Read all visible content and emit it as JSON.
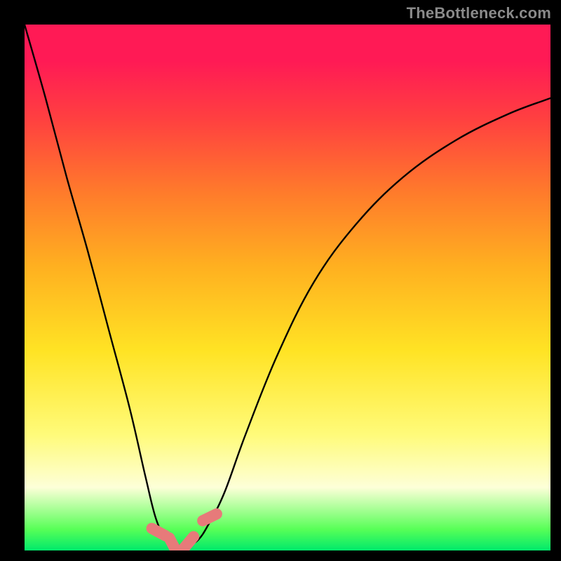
{
  "attribution": "TheBottleneck.com",
  "chart_data": {
    "type": "line",
    "title": "",
    "xlabel": "",
    "ylabel": "",
    "xlim": [
      0,
      100
    ],
    "ylim": [
      0,
      100
    ],
    "grid": false,
    "legend": false,
    "annotations": [],
    "series": [
      {
        "name": "bottleneck-curve",
        "color": "#000000",
        "x": [
          0,
          4,
          8,
          12,
          16,
          20,
          23,
          25,
          27,
          29,
          31,
          33,
          35,
          38,
          42,
          48,
          55,
          63,
          72,
          82,
          92,
          100
        ],
        "values": [
          100,
          86,
          71,
          57,
          42,
          27,
          14,
          6,
          2,
          1,
          1,
          2,
          5,
          11,
          22,
          37,
          51,
          62,
          71,
          78,
          83,
          86
        ]
      }
    ],
    "markers": [
      {
        "name": "optimal-marker-left",
        "shape": "pill",
        "color": "#e77a7a",
        "x": 25.5,
        "y": 3.5,
        "angle": -62
      },
      {
        "name": "optimal-marker-mid",
        "shape": "pill",
        "color": "#e77a7a",
        "x": 28.2,
        "y": 1.1,
        "angle": -28
      },
      {
        "name": "optimal-marker-low",
        "shape": "pill",
        "color": "#e77a7a",
        "x": 31.2,
        "y": 1.5,
        "angle": 40
      },
      {
        "name": "optimal-marker-right",
        "shape": "pill",
        "color": "#e77a7a",
        "x": 35.2,
        "y": 6.3,
        "angle": 64
      }
    ],
    "background_gradient": {
      "stops": [
        {
          "pos": 0,
          "color": "#ff1a55"
        },
        {
          "pos": 18,
          "color": "#ff4040"
        },
        {
          "pos": 32,
          "color": "#ff7b2b"
        },
        {
          "pos": 46,
          "color": "#ffb020"
        },
        {
          "pos": 62,
          "color": "#ffe324"
        },
        {
          "pos": 78,
          "color": "#fffb7a"
        },
        {
          "pos": 88,
          "color": "#fdffd8"
        },
        {
          "pos": 96,
          "color": "#57ff57"
        },
        {
          "pos": 100,
          "color": "#00e96b"
        }
      ]
    }
  }
}
